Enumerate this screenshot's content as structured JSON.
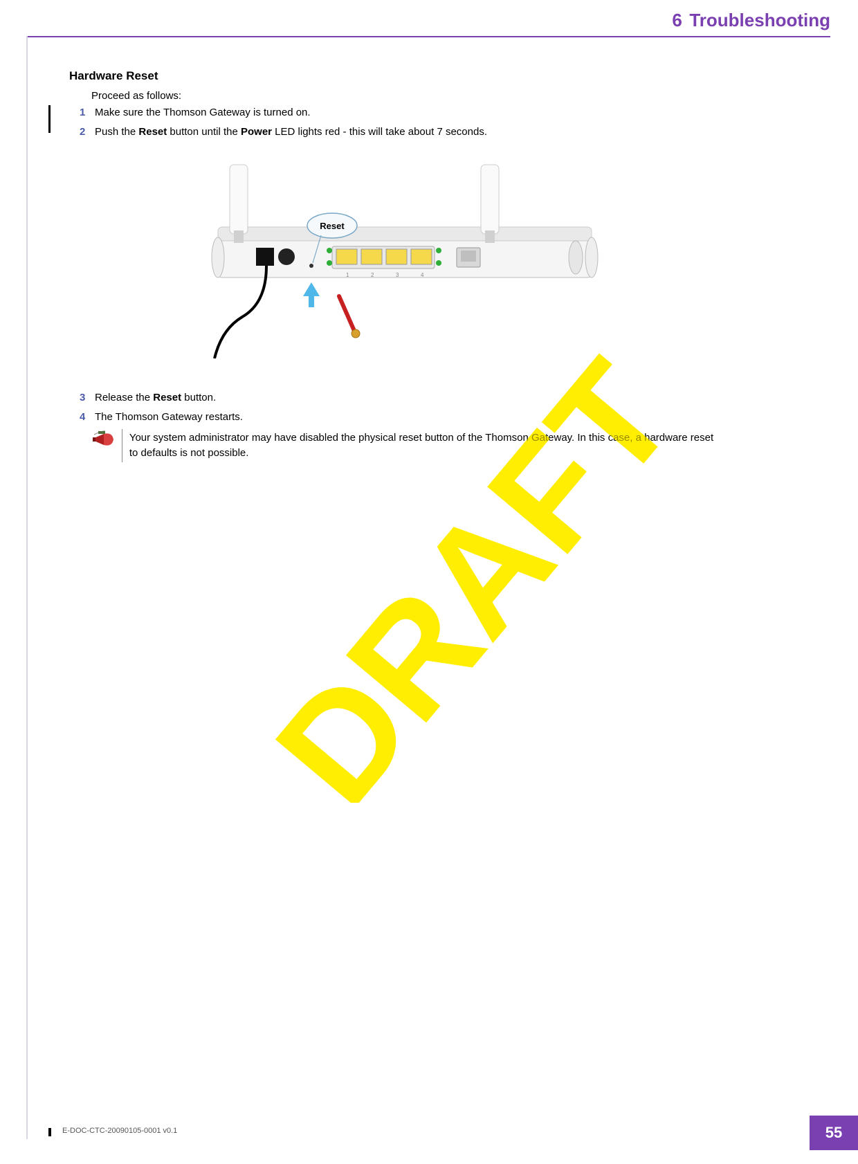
{
  "header": {
    "chapter_number": "6",
    "chapter_name": "Troubleshooting"
  },
  "section_title": "Hardware Reset",
  "intro": "Proceed as follows:",
  "steps": {
    "s1": {
      "n": "1",
      "t1": "Make sure the Thomson Gateway is turned on."
    },
    "s2": {
      "n": "2",
      "pre": "Push the ",
      "b1": "Reset",
      "mid": " button until the ",
      "b2": "Power",
      "post": " LED lights red - this will take about 7 seconds."
    },
    "s3": {
      "n": "3",
      "pre": "Release the ",
      "b1": "Reset",
      "post": " button."
    },
    "s4": {
      "n": "4",
      "t1": "The Thomson Gateway restarts."
    }
  },
  "illustration": {
    "callout_label": "Reset",
    "port_labels": [
      "1",
      "2",
      "3",
      "4"
    ]
  },
  "note": "Your system administrator may have disabled the physical reset button of the Thomson Gateway. In this case, a hardware reset to defaults is not possible.",
  "watermark": "DRAFT",
  "footer": {
    "doc_id": "E-DOC-CTC-20090105-0001 v0.1",
    "page_number": "55"
  }
}
